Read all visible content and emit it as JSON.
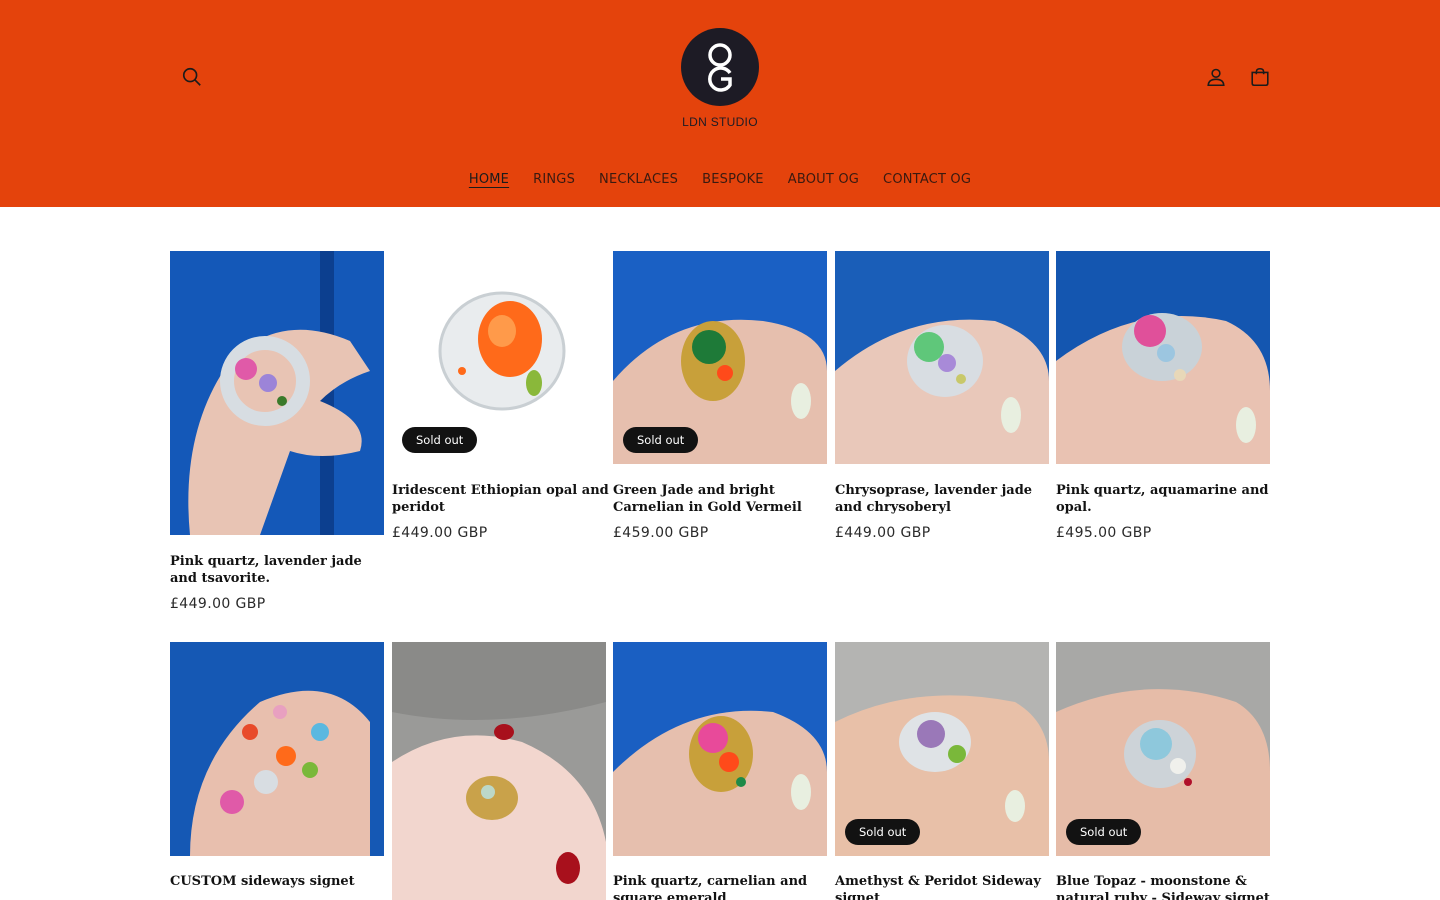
{
  "header": {
    "logo_text": "LDN STUDIO",
    "logo_mark": "OG",
    "nav": [
      {
        "label": "HOME",
        "active": true
      },
      {
        "label": "RINGS"
      },
      {
        "label": "NECKLACES"
      },
      {
        "label": "BESPOKE"
      },
      {
        "label": "ABOUT OG"
      },
      {
        "label": "CONTACT OG"
      }
    ],
    "icons": [
      "search-icon",
      "account-icon",
      "cart-icon"
    ]
  },
  "colors": {
    "header_bg": "#e4430c",
    "logo": "#1d1b25",
    "badge": "#121212",
    "blue_wall": "#1565c0"
  },
  "products": [
    {
      "title": "Pink quartz, lavender jade and tsavorite.",
      "price": "£449.00 GBP",
      "badge": ""
    },
    {
      "title": "Iridescent Ethiopian opal and peridot",
      "price": "£449.00 GBP",
      "badge": "Sold out"
    },
    {
      "title": "Green Jade and bright Carnelian in Gold Vermeil",
      "price": "£459.00 GBP",
      "badge": "Sold out"
    },
    {
      "title": "Chrysoprase, lavender jade and chrysoberyl",
      "price": "£449.00 GBP",
      "badge": ""
    },
    {
      "title": "Pink quartz, aquamarine and opal.",
      "price": "£495.00 GBP",
      "badge": ""
    },
    {
      "title": "CUSTOM sideways signet",
      "price": "",
      "badge": ""
    },
    {
      "title": "",
      "price": "",
      "badge": ""
    },
    {
      "title": "Pink quartz, carnelian and square emerald",
      "price": "",
      "badge": ""
    },
    {
      "title": "Amethyst & Peridot Sideway signet",
      "price": "",
      "badge": "Sold out"
    },
    {
      "title": "Blue Topaz - moonstone & natural ruby - Sideway signet",
      "price": "",
      "badge": "Sold out"
    }
  ]
}
